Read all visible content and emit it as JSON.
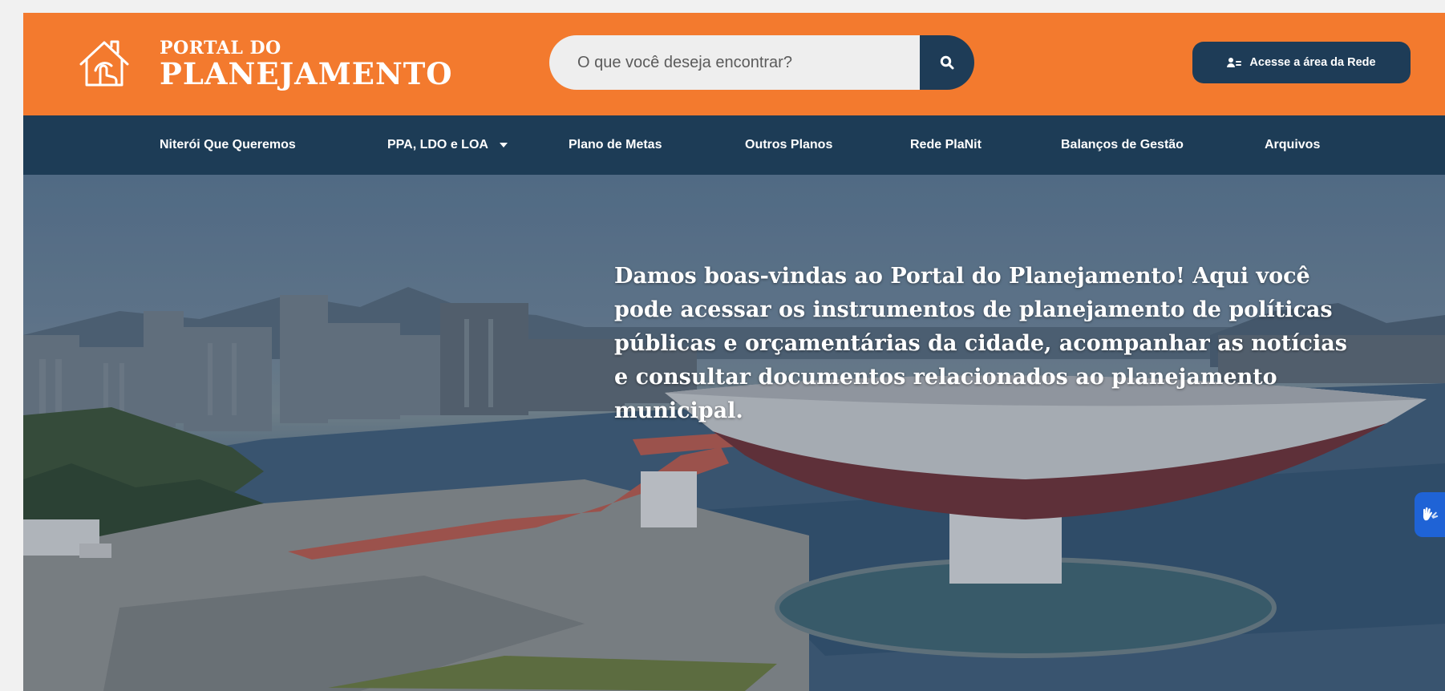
{
  "header": {
    "logo_line1": "PORTAL DO",
    "logo_line2": "PLANEJAMENTO",
    "logo_icon": "house-hand-icon",
    "search_placeholder": "O que você deseja encontrar?",
    "search_icon": "search-icon",
    "rede_button_label": "Acesse a área da Rede",
    "rede_button_icon": "users-icon",
    "brand_color": "#f37a2e",
    "navy_color": "#1d3c56"
  },
  "nav": {
    "items": [
      {
        "label": "Niterói Que Queremos"
      },
      {
        "label": "PPA, LDO e LOA",
        "dropdown": true
      },
      {
        "label": "Plano de Metas"
      },
      {
        "label": "Outros Planos"
      },
      {
        "label": "Rede PlaNit"
      },
      {
        "label": "Balanços de Gestão"
      },
      {
        "label": "Arquivos"
      }
    ]
  },
  "hero": {
    "welcome_text": "Damos boas-vindas ao Portal do Planejamento! Aqui você pode acessar os instrumentos de planejamento de políticas públicas e orçamentárias da cidade, acompanhar as notícias e consultar documentos relacionados ao planejamento municipal.",
    "accessibility_icon": "vlibras-hands-icon"
  }
}
